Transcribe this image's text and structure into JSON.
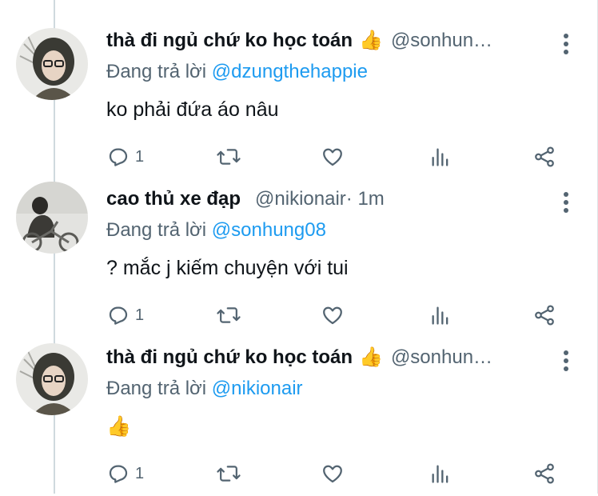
{
  "tweets": [
    {
      "display_name": "thà đi ngủ chứ ko học toán",
      "emoji": "👍",
      "handle": "@sonhun…",
      "meta": "",
      "reply_prefix": "Đang trả lời ",
      "reply_to": "@dzungthehappie",
      "text": "ko phải đứa áo nâu",
      "reply_count": "1"
    },
    {
      "display_name": "cao thủ xe đạp",
      "emoji": "",
      "handle": "@nikionair",
      "meta": " · 1m",
      "reply_prefix": "Đang trả lời ",
      "reply_to": "@sonhung08",
      "text": "? mắc j kiếm chuyện với tui",
      "reply_count": "1"
    },
    {
      "display_name": "thà đi ngủ chứ ko học toán",
      "emoji": "👍",
      "handle": "@sonhun…",
      "meta": "",
      "reply_prefix": "Đang trả lời ",
      "reply_to": "@nikionair",
      "text": "👍",
      "reply_count": "1"
    }
  ],
  "icons": {
    "reply": "reply-icon",
    "retweet": "retweet-icon",
    "like": "like-icon",
    "stats": "stats-icon",
    "share": "share-icon",
    "more": "more-options-icon"
  },
  "colors": {
    "name": "#0f1419",
    "secondary": "#536471",
    "mention": "#1d9bf0",
    "thread_line": "#cfd9de"
  }
}
